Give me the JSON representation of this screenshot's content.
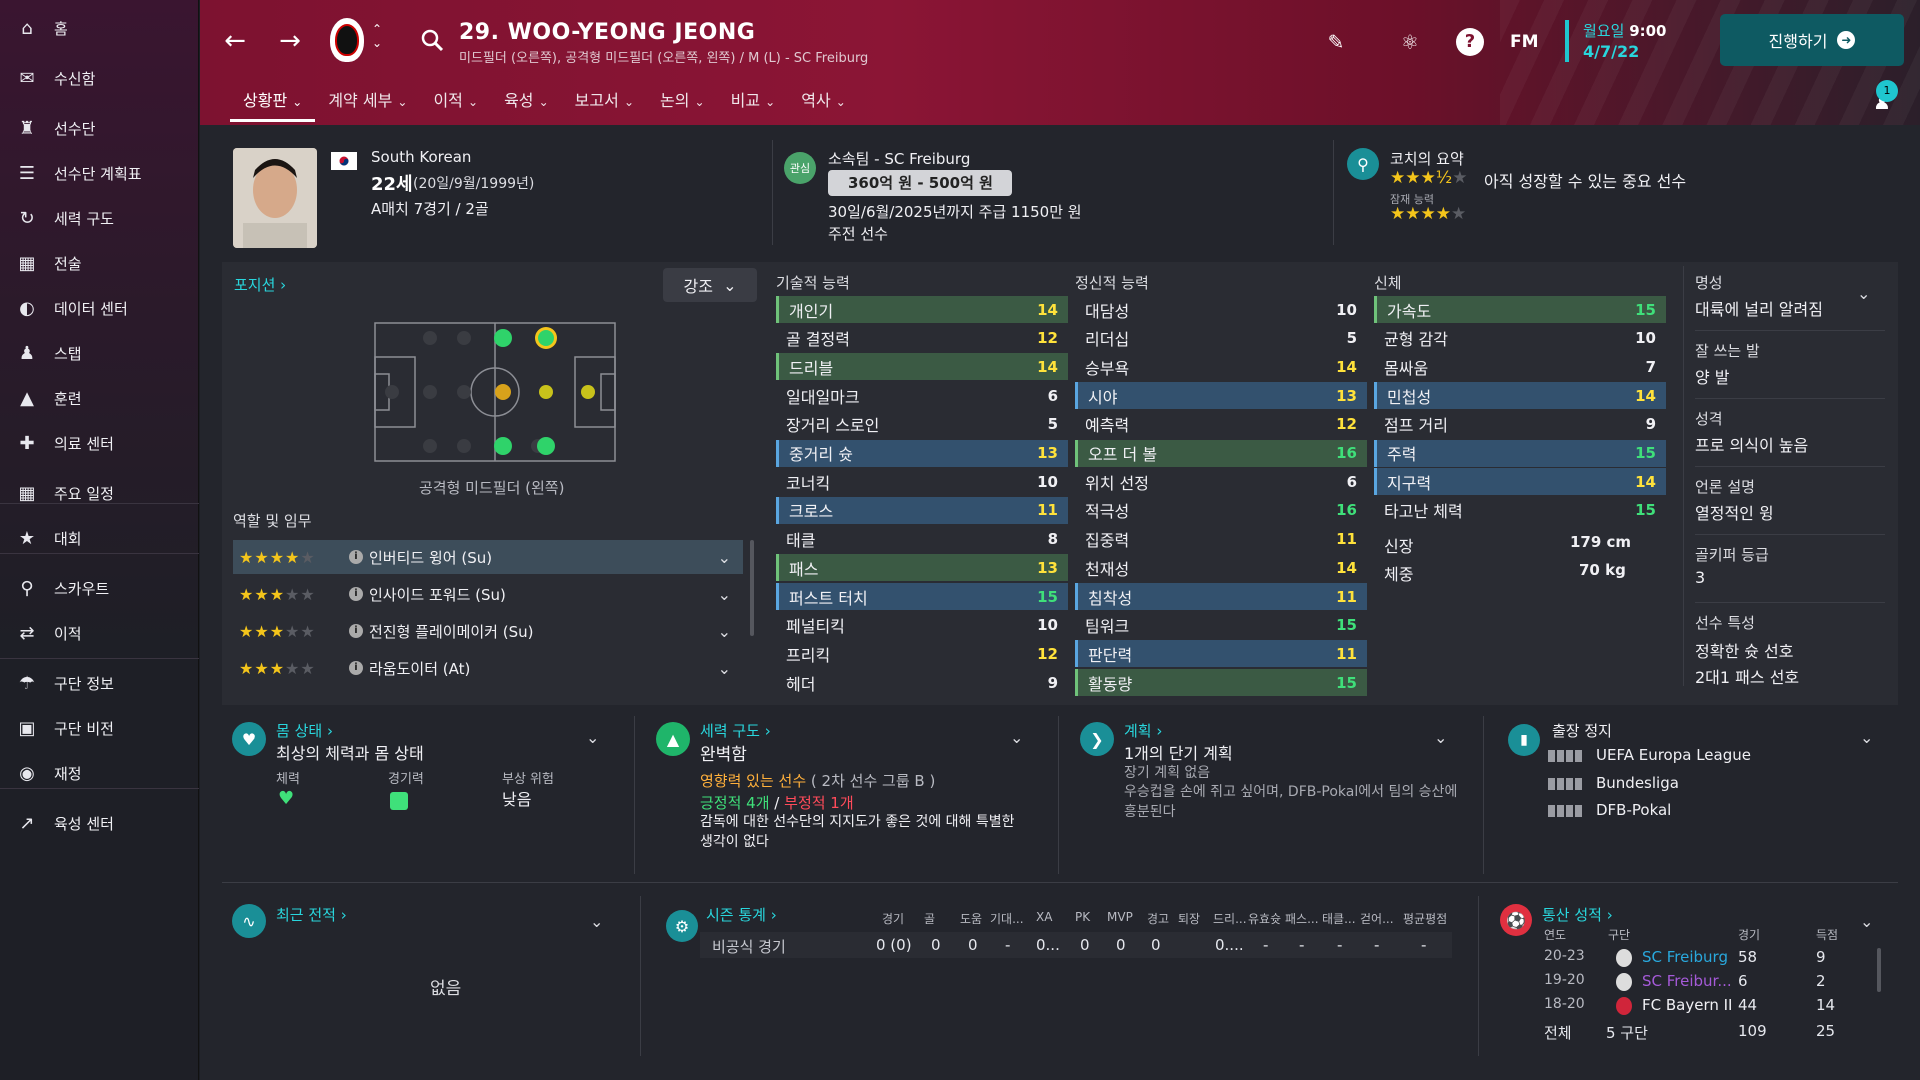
{
  "sidebar": {
    "items": [
      {
        "label": "홈",
        "icon": "home-icon"
      },
      {
        "label": "수신함",
        "icon": "inbox-icon"
      },
      {
        "label": "선수단",
        "icon": "squad-icon"
      },
      {
        "label": "선수단 계획표",
        "icon": "squad-planner-icon"
      },
      {
        "label": "세력 구도",
        "icon": "dynamics-icon"
      },
      {
        "label": "전술",
        "icon": "tactics-icon"
      },
      {
        "label": "데이터 센터",
        "icon": "data-hub-icon"
      },
      {
        "label": "스탭",
        "icon": "staff-icon"
      },
      {
        "label": "훈련",
        "icon": "training-icon"
      },
      {
        "label": "의료 센터",
        "icon": "medical-icon"
      },
      {
        "label": "주요 일정",
        "icon": "calendar-icon"
      },
      {
        "label": "대회",
        "icon": "trophy-icon"
      },
      {
        "label": "스카우트",
        "icon": "scouting-icon"
      },
      {
        "label": "이적",
        "icon": "transfers-icon"
      },
      {
        "label": "구단 정보",
        "icon": "club-info-icon"
      },
      {
        "label": "구단 비전",
        "icon": "club-vision-icon"
      },
      {
        "label": "재정",
        "icon": "finances-icon"
      },
      {
        "label": "육성 센터",
        "icon": "development-icon"
      }
    ]
  },
  "header": {
    "player_name": "29. WOO-YEONG JEONG",
    "subtitle": "미드필더 (오른쪽), 공격형 미드필더 (오른쪽, 왼쪽) / M (L) - SC Freiburg",
    "day": "월요일",
    "time": "9:00",
    "date": "4/7/22",
    "continue_label": "진행하기",
    "notif_count": "1",
    "fm_label": "FM",
    "tabs": [
      "상황판",
      "계약 세부",
      "이적",
      "육성",
      "보고서",
      "논의",
      "비교",
      "역사"
    ]
  },
  "profile": {
    "nationality": "South Korean",
    "age": "22세",
    "dob": "(20일/9월/1999년)",
    "caps": "A매치 7경기 / 2골",
    "interest_badge": "관심",
    "club": "소속팀 - SC Freiburg",
    "value": "360억 원 - 500억 원",
    "contract": "30일/6월/2025년까지 주급 1150만 원",
    "status": "주전 선수",
    "coach_title": "코치의 요약",
    "coach_summary": "아직 성장할 수 있는 중요 선수",
    "coach_stars": 3.5,
    "potential_label": "잠재 능력",
    "potential_stars": 4
  },
  "position": {
    "title": "포지션",
    "highlight_label": "강조",
    "pos_caption": "공격형 미드필더 (왼쪽)",
    "roles_title": "역할 및 임무",
    "roles": [
      {
        "name": "인버티드 윙어 (Su)",
        "stars": 3.5
      },
      {
        "name": "인사이드 포워드 (Su)",
        "stars": 3
      },
      {
        "name": "전진형 플레이메이커 (Su)",
        "stars": 3
      },
      {
        "name": "라움도이터 (At)",
        "stars": 2.5
      }
    ]
  },
  "attributes": {
    "technical_title": "기술적 능력",
    "mental_title": "정신적 능력",
    "physical_title": "신체",
    "technical": [
      {
        "name": "개인기",
        "value": "14",
        "hl": "g"
      },
      {
        "name": "골 결정력",
        "value": "12",
        "hl": ""
      },
      {
        "name": "드리블",
        "value": "14",
        "hl": "g"
      },
      {
        "name": "일대일마크",
        "value": "6",
        "hl": ""
      },
      {
        "name": "장거리 스로인",
        "value": "5",
        "hl": ""
      },
      {
        "name": "중거리 슛",
        "value": "13",
        "hl": "b"
      },
      {
        "name": "코너킥",
        "value": "10",
        "hl": ""
      },
      {
        "name": "크로스",
        "value": "11",
        "hl": "b"
      },
      {
        "name": "태클",
        "value": "8",
        "hl": ""
      },
      {
        "name": "패스",
        "value": "13",
        "hl": "g"
      },
      {
        "name": "퍼스트 터치",
        "value": "15",
        "hl": "b"
      },
      {
        "name": "페널티킥",
        "value": "10",
        "hl": ""
      },
      {
        "name": "프리킥",
        "value": "12",
        "hl": ""
      },
      {
        "name": "헤더",
        "value": "9",
        "hl": ""
      }
    ],
    "mental": [
      {
        "name": "대담성",
        "value": "10",
        "hl": ""
      },
      {
        "name": "리더십",
        "value": "5",
        "hl": ""
      },
      {
        "name": "승부욕",
        "value": "14",
        "hl": ""
      },
      {
        "name": "시야",
        "value": "13",
        "hl": "b"
      },
      {
        "name": "예측력",
        "value": "12",
        "hl": ""
      },
      {
        "name": "오프 더 볼",
        "value": "16",
        "hl": "g"
      },
      {
        "name": "위치 선정",
        "value": "6",
        "hl": ""
      },
      {
        "name": "적극성",
        "value": "16",
        "hl": ""
      },
      {
        "name": "집중력",
        "value": "11",
        "hl": ""
      },
      {
        "name": "천재성",
        "value": "14",
        "hl": ""
      },
      {
        "name": "침착성",
        "value": "11",
        "hl": "b"
      },
      {
        "name": "팀워크",
        "value": "15",
        "hl": ""
      },
      {
        "name": "판단력",
        "value": "11",
        "hl": "b"
      },
      {
        "name": "활동량",
        "value": "15",
        "hl": "g"
      }
    ],
    "physical": [
      {
        "name": "가속도",
        "value": "15",
        "hl": "g"
      },
      {
        "name": "균형 감각",
        "value": "10",
        "hl": ""
      },
      {
        "name": "몸싸움",
        "value": "7",
        "hl": ""
      },
      {
        "name": "민첩성",
        "value": "14",
        "hl": "b"
      },
      {
        "name": "점프 거리",
        "value": "9",
        "hl": ""
      },
      {
        "name": "주력",
        "value": "15",
        "hl": "b"
      },
      {
        "name": "지구력",
        "value": "14",
        "hl": "b"
      },
      {
        "name": "타고난 체력",
        "value": "15",
        "hl": ""
      }
    ],
    "height_label": "신장",
    "height": "179 cm",
    "weight_label": "체중",
    "weight": "70 kg"
  },
  "info": {
    "reputation_label": "명성",
    "reputation": "대륙에 널리 알려짐",
    "foot_label": "잘 쓰는 발",
    "foot": "양 발",
    "personality_label": "성격",
    "personality": "프로 의식이 높음",
    "media_label": "언론 설명",
    "media": "열정적인 윙",
    "gk_label": "골키퍼 등급",
    "gk": "3",
    "traits_label": "선수 특성",
    "traits": [
      "정확한 슛 선호",
      "2대1 패스 선호"
    ]
  },
  "condition": {
    "title": "몸 상태",
    "summary": "최상의 체력과 몸 상태",
    "fitness_label": "체력",
    "sharpness_label": "경기력",
    "injury_label": "부상 위험",
    "injury": "낮음"
  },
  "dynamics": {
    "title": "세력 구도",
    "summary": "완벽함",
    "influence": "영향력 있는 선수",
    "group": "( 2차 선수 그룹 B )",
    "positive": "긍정적 4개",
    "slash": "/",
    "negative": "부정적 1개",
    "note": "감독에 대한 선수단의 지지도가 좋은 것에 대해 특별한 생각이 없다"
  },
  "plans": {
    "title": "계획",
    "summary": "1개의 단기 계획",
    "long": "장기 계획 없음",
    "note": "우승컵을 손에 쥐고 싶어며, DFB-Pokal에서 팀의 승산에 흥분된다"
  },
  "bans": {
    "title": "출장 정지",
    "items": [
      "UEFA Europa League",
      "Bundesliga",
      "DFB-Pokal"
    ]
  },
  "form": {
    "title": "최근 전적",
    "empty": "없음"
  },
  "season": {
    "title": "시즌 통계",
    "headers": [
      "경기",
      "골",
      "도움",
      "기대...",
      "XA",
      "PK",
      "MVP",
      "경고",
      "퇴장",
      "드리...",
      "유효슛",
      "패스...",
      "태클...",
      "걷어...",
      "평균평점"
    ],
    "row_label": "비공식 경기",
    "row": [
      "0 (0)",
      "0",
      "0",
      "-",
      "0...",
      "0",
      "0",
      "0",
      "0....",
      "-",
      "-",
      "-",
      "-",
      "-"
    ]
  },
  "career": {
    "title": "통산 성적",
    "headers": [
      "연도",
      "구단",
      "경기",
      "득점"
    ],
    "rows": [
      {
        "year": "20-23",
        "club": "SC Freiburg",
        "apps": "58",
        "goals": "9"
      },
      {
        "year": "19-20",
        "club": "SC Freibur...",
        "apps": "6",
        "goals": "2"
      },
      {
        "year": "18-20",
        "club": "FC Bayern II",
        "apps": "44",
        "goals": "14"
      }
    ],
    "total_label": "전체",
    "total_clubs": "5 구단",
    "total_apps": "109",
    "total_goals": "25"
  },
  "colors": {
    "accent": "#29d6dd",
    "highlight_good": "#3fe07a",
    "highlight_yellow": "#ffe23b",
    "brand": "#8b1535"
  }
}
